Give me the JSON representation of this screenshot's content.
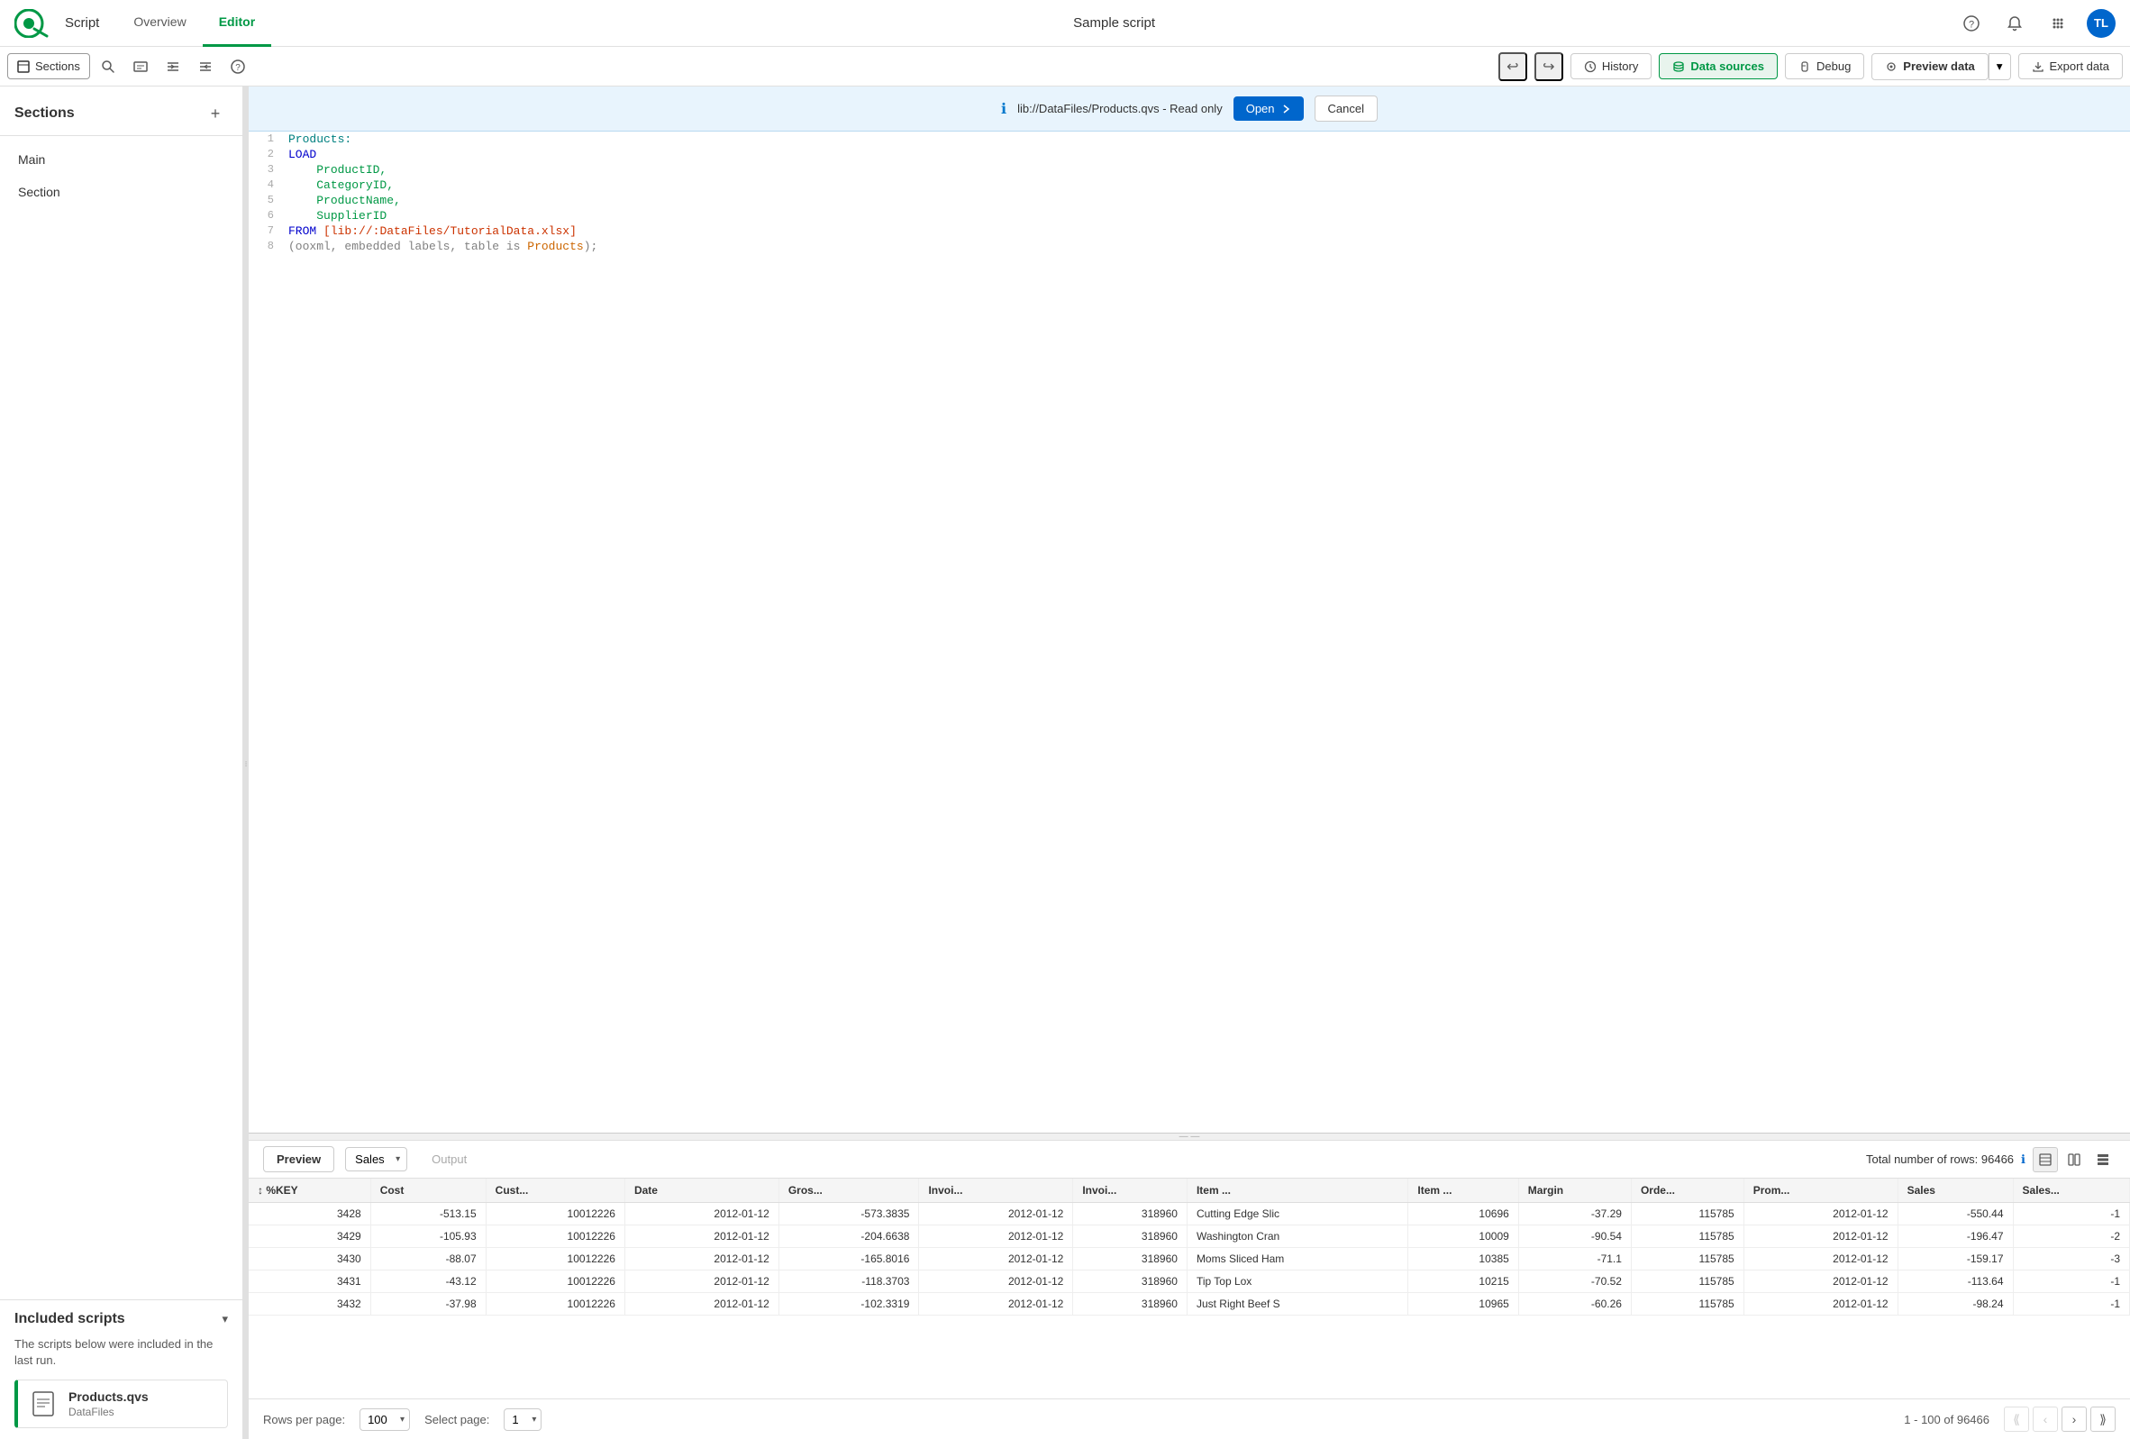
{
  "app": {
    "logo_text": "Qlik",
    "app_name": "Script",
    "nav_tabs": [
      "Overview",
      "Editor"
    ],
    "active_tab": "Editor",
    "title": "Sample script"
  },
  "toolbar": {
    "sections_label": "Sections",
    "history_label": "History",
    "datasources_label": "Data sources",
    "debug_label": "Debug",
    "preview_label": "Preview data",
    "export_label": "Export data",
    "undo_icon": "↩",
    "redo_icon": "↪",
    "help_icon": "?"
  },
  "sidebar": {
    "title": "Sections",
    "add_icon": "+",
    "items": [
      {
        "label": "Main"
      },
      {
        "label": "Section"
      }
    ]
  },
  "included_scripts": {
    "title": "Included scripts",
    "toggle_icon": "▾",
    "description": "The scripts below were included in the last run.",
    "files": [
      {
        "name": "Products.qvs",
        "path": "DataFiles"
      }
    ]
  },
  "readonly_banner": {
    "file_path": "lib://DataFiles/Products.qvs - Read only",
    "open_label": "Open",
    "cancel_label": "Cancel"
  },
  "code": {
    "lines": [
      {
        "num": 1,
        "tokens": [
          {
            "text": "Products:",
            "cls": "kw-teal"
          }
        ]
      },
      {
        "num": 2,
        "tokens": [
          {
            "text": "LOAD",
            "cls": "kw-blue"
          }
        ]
      },
      {
        "num": 3,
        "tokens": [
          {
            "text": "    ProductID,",
            "cls": "kw-field"
          }
        ]
      },
      {
        "num": 4,
        "tokens": [
          {
            "text": "    CategoryID,",
            "cls": "kw-field"
          }
        ]
      },
      {
        "num": 5,
        "tokens": [
          {
            "text": "    ProductName,",
            "cls": "kw-field"
          }
        ]
      },
      {
        "num": 6,
        "tokens": [
          {
            "text": "    SupplierID",
            "cls": "kw-field"
          }
        ]
      },
      {
        "num": 7,
        "tokens": [
          {
            "text": "FROM",
            "cls": "kw-blue"
          },
          {
            "text": " [lib://:DataFiles/TutorialData.xlsx]",
            "cls": ""
          }
        ]
      },
      {
        "num": 8,
        "tokens": [
          {
            "text": "(ooxml, embedded labels, table is",
            "cls": "kw-gray"
          },
          {
            "text": " Products",
            "cls": "kw-orange"
          },
          {
            "text": ");",
            "cls": "kw-gray"
          }
        ]
      }
    ]
  },
  "preview": {
    "btn_label": "Preview",
    "dropdown_label": "Sales",
    "output_label": "Output",
    "rows_info": "Total number of rows: 96466",
    "rows_per_page_label": "Rows per page:",
    "rows_per_page_value": "100",
    "select_page_label": "Select page:",
    "select_page_value": "1",
    "pagination_info": "1 - 100 of 96466",
    "table": {
      "columns": [
        "%KEY",
        "Cost",
        "Cust...",
        "Date",
        "Gros...",
        "Invoi...",
        "Invoi...",
        "Item ...",
        "Item ...",
        "Margin",
        "Orde...",
        "Prom...",
        "Sales",
        "Sales..."
      ],
      "rows": [
        [
          "3428",
          "-513.15",
          "10012226",
          "2012-01-12",
          "-573.3835",
          "2012-01-12",
          "318960",
          "Cutting Edge Slic",
          "10696",
          "-37.29",
          "115785",
          "2012-01-12",
          "-550.44",
          "-1"
        ],
        [
          "3429",
          "-105.93",
          "10012226",
          "2012-01-12",
          "-204.6638",
          "2012-01-12",
          "318960",
          "Washington Cran",
          "10009",
          "-90.54",
          "115785",
          "2012-01-12",
          "-196.47",
          "-2"
        ],
        [
          "3430",
          "-88.07",
          "10012226",
          "2012-01-12",
          "-165.8016",
          "2012-01-12",
          "318960",
          "Moms Sliced Ham",
          "10385",
          "-71.1",
          "115785",
          "2012-01-12",
          "-159.17",
          "-3"
        ],
        [
          "3431",
          "-43.12",
          "10012226",
          "2012-01-12",
          "-118.3703",
          "2012-01-12",
          "318960",
          "Tip Top Lox",
          "10215",
          "-70.52",
          "115785",
          "2012-01-12",
          "-113.64",
          "-1"
        ],
        [
          "3432",
          "-37.98",
          "10012226",
          "2012-01-12",
          "-102.3319",
          "2012-01-12",
          "318960",
          "Just Right Beef S",
          "10965",
          "-60.26",
          "115785",
          "2012-01-12",
          "-98.24",
          "-1"
        ]
      ]
    }
  },
  "icons": {
    "search": "🔍",
    "code": "⌥",
    "indent_right": "→|",
    "indent_left": "|←",
    "help": "?",
    "bell": "🔔",
    "apps": "⋮⋮⋮",
    "history_clock": "⏱",
    "datasources_db": "🗄",
    "debug_bug": "🐞",
    "eye": "👁",
    "export": "↗",
    "file_script": "📄",
    "open_link": "↗"
  }
}
